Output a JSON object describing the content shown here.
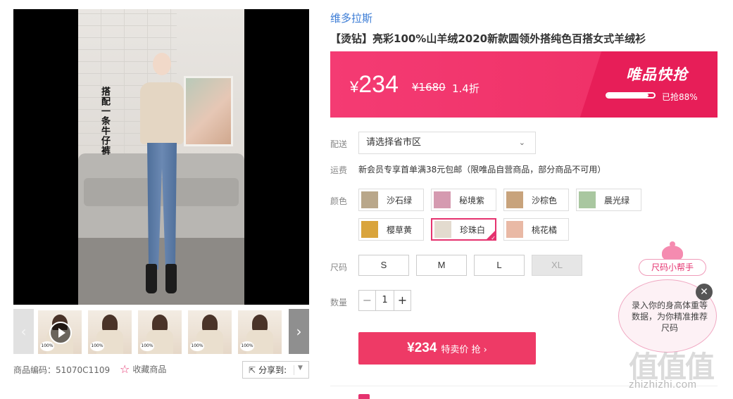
{
  "gallery": {
    "video_caption": "搭配一条牛仔裤",
    "thumb_badge": "100%",
    "product_code": "商品编码：51070C1109",
    "favorite_label": "收藏商品",
    "share_label": "分享到:"
  },
  "product": {
    "brand": "维多拉斯",
    "title": "【烫钻】亮彩100%山羊绒2020新款圆领外搭纯色百搭女式羊绒衫"
  },
  "price": {
    "current": "234",
    "currency": "¥",
    "original": "¥1680",
    "discount": "1.4折",
    "flash_sale_title": "唯品快抢",
    "sold_text": "已抢88%",
    "sold_fraction": 0.88,
    "accent": "#f43b73"
  },
  "delivery": {
    "label": "配送",
    "select_value": "请选择省市区"
  },
  "freight": {
    "label": "运费",
    "text": "新会员专享首单满38元包邮（限唯品自营商品，部分商品不可用）"
  },
  "colors": {
    "label": "颜色",
    "options": [
      {
        "name": "沙石绿",
        "swatch": "#b9a78a"
      },
      {
        "name": "秘境紫",
        "swatch": "#d59ab0"
      },
      {
        "name": "沙棕色",
        "swatch": "#c8a37c"
      },
      {
        "name": "晨光绿",
        "swatch": "#a9c7a0"
      },
      {
        "name": "樱草黄",
        "swatch": "#d9a43c"
      },
      {
        "name": "珍珠白",
        "swatch": "#e3dbcf"
      },
      {
        "name": "桃花橘",
        "swatch": "#e9b9a5"
      }
    ],
    "selected": "珍珠白"
  },
  "sizes": {
    "label": "尺码",
    "options": [
      "S",
      "M",
      "L",
      "XL"
    ],
    "disabled": [
      "XL"
    ]
  },
  "quantity": {
    "label": "数量",
    "value": "1",
    "minus": "−",
    "plus": "+"
  },
  "buy": {
    "price": "¥234",
    "label": "特卖价 抢 ›"
  },
  "size_helper": {
    "pill": "尺码小帮手",
    "bubble_text": "录入你的身高体重等数据，为你精准推荐尺码",
    "close": "✕"
  },
  "watermark": {
    "logo": "值值值",
    "url": "zhizhizhi.com"
  }
}
